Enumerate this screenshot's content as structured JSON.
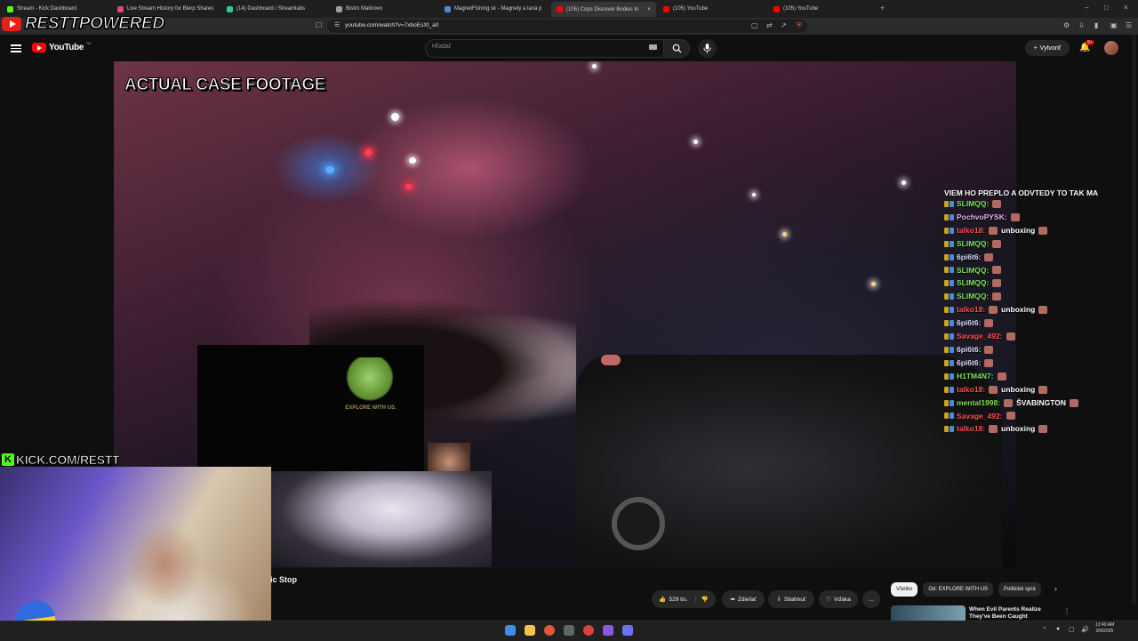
{
  "browser": {
    "tabs": [
      {
        "title": "Stream - Kick Dashboard",
        "color": "#53fc18"
      },
      {
        "title": "Live Stream History for Blerp Shares",
        "color": "#e0457b"
      },
      {
        "title": "(14) Dashboard / Streamlabs",
        "color": "#31c3a2"
      },
      {
        "title": "Bistro Malinovo",
        "color": "#9aa0a6"
      },
      {
        "title": "MagnetFishing.sk - Magnety a laná p",
        "color": "#4a8bd8"
      },
      {
        "title": "(105) Cops Discover Bodies In",
        "color": "#ff0000"
      },
      {
        "title": "(105) YouTube",
        "color": "#ff0000"
      },
      {
        "title": "(105) YouTube",
        "color": "#ff0000"
      }
    ],
    "active_tab_close": "×",
    "new_tab": "+",
    "url": "youtube.com/watch?v=7xboEsXt_a0",
    "window_controls": [
      "–",
      "□",
      "×"
    ]
  },
  "overlay": {
    "brand_text": "RESTTPOWERED",
    "kick_letter": "K",
    "kick_url": "KICK.COM/RESTT"
  },
  "youtube": {
    "logo_text": "YouTube",
    "region": "SK",
    "search_placeholder": "Hľadať",
    "create_label": "Vytvoriť",
    "create_icon": "+",
    "notif_badge": "9+"
  },
  "video": {
    "footage_label": "ACTUAL CASE FOOTAGE",
    "explore_text": "EXPLORE WITH US.",
    "title_partial": "ic Stop"
  },
  "chat": {
    "first_line": "VIEM HO PREPLO A ODVTEDY TO TAK MA",
    "messages": [
      {
        "user": "SLIMQQ:",
        "text": "",
        "color": "#7fe05a"
      },
      {
        "user": "PochvoPYSK:",
        "text": "",
        "color": "#e3aef0"
      },
      {
        "user": "talko18:",
        "text": "unboxing",
        "color": "#ff4f4f"
      },
      {
        "user": "SLIMQQ:",
        "text": "",
        "color": "#7fe05a"
      },
      {
        "user": "6pi6t6:",
        "text": "",
        "color": "#d9d9ff"
      },
      {
        "user": "SLIMQQ:",
        "text": "",
        "color": "#7fe05a"
      },
      {
        "user": "SLIMQQ:",
        "text": "",
        "color": "#7fe05a"
      },
      {
        "user": "SLIMQQ:",
        "text": "",
        "color": "#7fe05a"
      },
      {
        "user": "talko18:",
        "text": "unboxing",
        "color": "#ff4f4f"
      },
      {
        "user": "6pi6t6:",
        "text": "",
        "color": "#d9d9ff"
      },
      {
        "user": "Savage_492:",
        "text": "",
        "color": "#ff4f4f"
      },
      {
        "user": "6pi6t6:",
        "text": "",
        "color": "#d9d9ff"
      },
      {
        "user": "6pi6t6:",
        "text": "",
        "color": "#d9d9ff"
      },
      {
        "user": "H1TM4N7:",
        "text": "",
        "color": "#7fe05a"
      },
      {
        "user": "talko18:",
        "text": "unboxing",
        "color": "#ff4f4f"
      },
      {
        "user": "mental1998:",
        "text": "ŠVABINGTON",
        "color": "#7fe05a"
      },
      {
        "user": "Savage_492:",
        "text": "",
        "color": "#ff4f4f"
      },
      {
        "user": "talko18:",
        "text": "unboxing",
        "color": "#ff4f4f"
      }
    ]
  },
  "actions": {
    "likes": "529 tis.",
    "share": "Zdieľať",
    "download": "Stiahnuť",
    "thanks": "Vďaka",
    "more": "…"
  },
  "chips": [
    "Všetko",
    "Od: EXPLORE WITH US",
    "Politické sprá"
  ],
  "recommended": {
    "title": "When Evil Parents Realize They've Been Caught"
  },
  "taskbar": {
    "time": "12:40 AM",
    "date": "9/9/2025"
  }
}
